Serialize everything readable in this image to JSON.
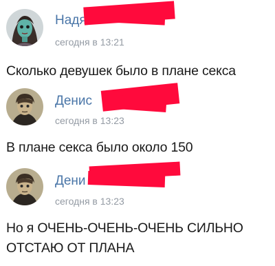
{
  "posts": [
    {
      "author": "Надя",
      "time": "сегодня в 13:21",
      "text": "Сколько девушек было в плане секса",
      "avatar_icon": "female-zombie-avatar"
    },
    {
      "author": "Денис",
      "time": "сегодня в 13:23",
      "text": "В плане секса было около 150",
      "avatar_icon": "male-sketch-avatar"
    },
    {
      "author": "Дени",
      "time": "сегодня в 13:23",
      "text": "Но я ОЧЕНЬ-ОЧЕНЬ-ОЧЕНЬ СИЛЬНО ОТСТАЮ ОТ ПЛАНА",
      "avatar_icon": "male-sketch-avatar"
    }
  ],
  "colors": {
    "author": "#4a76a8",
    "timestamp": "#939aa3",
    "redaction": "#ff0a3c",
    "text": "#1a1a1a"
  }
}
